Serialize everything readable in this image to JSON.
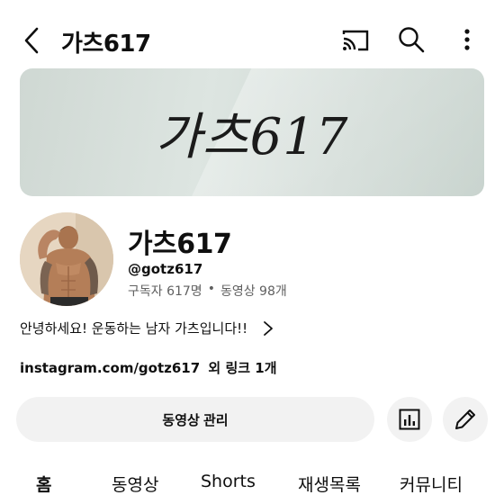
{
  "header": {
    "back_icon": "chevron-left-icon",
    "title": "가츠617",
    "actions": [
      {
        "icon": "cast-icon"
      },
      {
        "icon": "search-icon"
      },
      {
        "icon": "more-vertical-icon"
      }
    ]
  },
  "banner": {
    "text": "가츠617"
  },
  "channel": {
    "name": "가츠617",
    "handle": "@gotz617",
    "subscribers": "구독자 617명",
    "separator": "•",
    "videos": "동영상 98개",
    "description": "안녕하세요! 운동하는 남자 가츠입니다!!",
    "link": "instagram.com/gotz617",
    "more_links": "외 링크 1개"
  },
  "buttons": {
    "manage_videos": "동영상 관리",
    "analytics_icon": "analytics-icon",
    "edit_icon": "pencil-icon"
  },
  "tabs": [
    {
      "label": "홈",
      "active": true
    },
    {
      "label": "동영상",
      "active": false
    },
    {
      "label": "Shorts",
      "active": false
    },
    {
      "label": "재생목록",
      "active": false
    },
    {
      "label": "커뮤니티",
      "active": false
    }
  ]
}
